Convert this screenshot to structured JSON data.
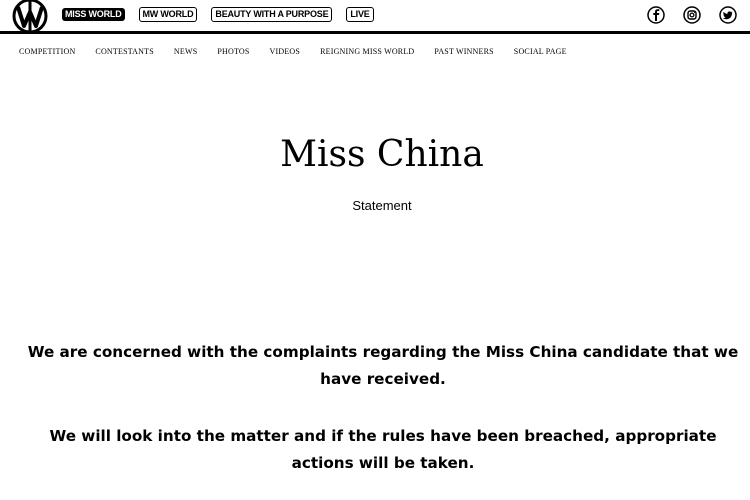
{
  "logo": {
    "icon": "miss-world-logo-icon"
  },
  "brand_links": [
    {
      "label": "MISS WORLD",
      "style": "solid"
    },
    {
      "label": "MW WORLD",
      "style": "outline"
    },
    {
      "label": "BEAUTY WITH A PURPOSE",
      "style": "outline"
    },
    {
      "label": "LIVE",
      "style": "outline"
    }
  ],
  "social_icons": [
    "facebook-icon",
    "instagram-icon",
    "twitter-icon"
  ],
  "nav": {
    "items": [
      "COMPETITION",
      "CONTESTANTS",
      "NEWS",
      "PHOTOS",
      "VIDEOS",
      "REIGNING MISS WORLD",
      "PAST WINNERS",
      "SOCIAL PAGE"
    ]
  },
  "article": {
    "title": "Miss China",
    "subtitle": "Statement",
    "paragraphs": [
      "We are concerned with the complaints regarding the Miss China candidate that we have received.",
      "We will look into the matter and if the rules have been breached, appropriate actions will be taken."
    ]
  },
  "colors": {
    "text": "#000000",
    "background": "#ffffff"
  }
}
